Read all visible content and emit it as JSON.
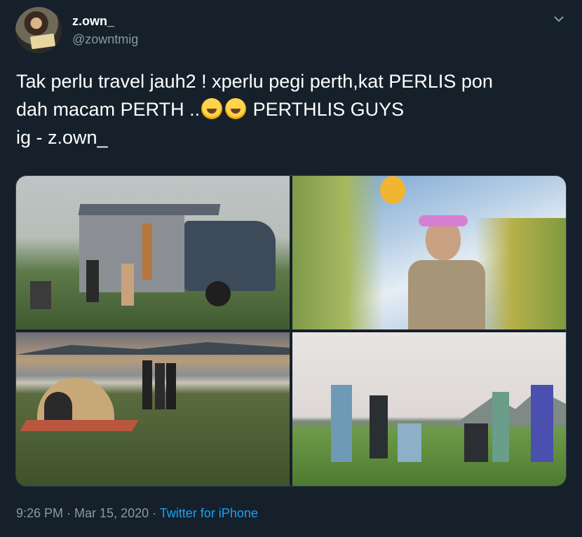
{
  "author": {
    "name": "z.own_",
    "handle": "@zowntmig"
  },
  "tweet": {
    "line1": "Tak perlu travel jauh2 ! xperlu pegi perth,kat PERLIS pon",
    "line2_prefix": "dah macam PERTH ..",
    "line2_suffix": " PERTHLIS GUYS",
    "line3": "ig - z.own_",
    "emojis": [
      "rolling-on-the-floor-laughing",
      "rolling-on-the-floor-laughing"
    ]
  },
  "media": {
    "photos": [
      "camper-truck-photo",
      "sunflower-photo",
      "lakeside-tent-photo",
      "group-field-photo"
    ]
  },
  "meta": {
    "time": "9:26 PM",
    "separator": " · ",
    "date": "Mar 15, 2020",
    "source": "Twitter for iPhone"
  },
  "colors": {
    "background": "#15202b",
    "text": "#ffffff",
    "secondary": "#8899a6",
    "link": "#1da1f2"
  }
}
